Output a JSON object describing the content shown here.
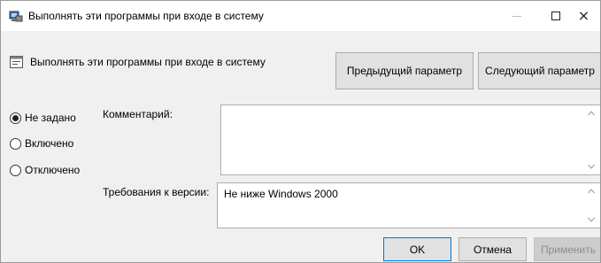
{
  "window": {
    "title": "Выполнять эти программы при входе в систему",
    "minimize_icon": "minimize-icon",
    "maximize_icon": "maximize-icon",
    "close_icon": "close-icon",
    "close_glyph": "×"
  },
  "header": {
    "policy_name": "Выполнять эти программы при входе в систему",
    "prev_button": "Предыдущий параметр",
    "next_button": "Следующий параметр"
  },
  "state": {
    "options": [
      {
        "label": "Не задано",
        "selected": true
      },
      {
        "label": "Включено",
        "selected": false
      },
      {
        "label": "Отключено",
        "selected": false
      }
    ]
  },
  "comment": {
    "label": "Комментарий:",
    "value": ""
  },
  "requirements": {
    "label": "Требования к версии:",
    "value": "Не ниже Windows 2000"
  },
  "buttons": {
    "ok": "OK",
    "cancel": "Отмена",
    "apply": "Применить"
  },
  "colors": {
    "ok_border": "#0078d7",
    "button_bg": "#e1e1e1",
    "disabled_text": "#8c8c8c"
  }
}
